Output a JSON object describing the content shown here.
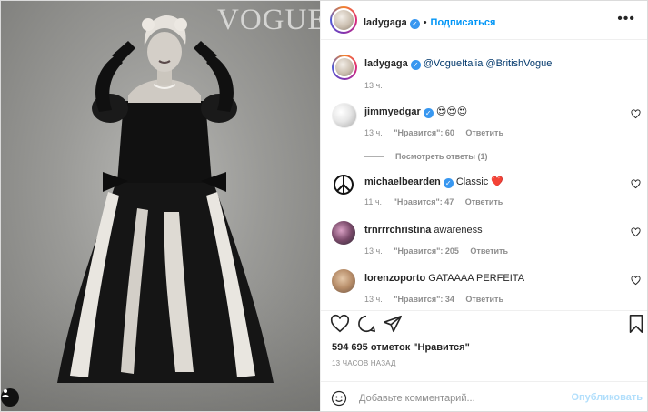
{
  "post": {
    "author": "ladygaga",
    "follow_label": "Подписаться",
    "separator": "•",
    "more_label": "•••",
    "photo": {
      "masthead": "VOGUE"
    },
    "caption": {
      "username": "ladygaga",
      "text": "@VogueItalia @BritishVogue",
      "time": "13 ч."
    },
    "comments": [
      {
        "username": "jimmyedgar",
        "verified": true,
        "text": "😍😍😍",
        "time": "13 ч.",
        "likes": "\"Нравится\": 60",
        "reply": "Ответить",
        "view_replies": "Посмотреть ответы (1)"
      },
      {
        "username": "michaelbearden",
        "verified": true,
        "text": "Classic ❤️",
        "time": "11 ч.",
        "likes": "\"Нравится\": 47",
        "reply": "Ответить"
      },
      {
        "username": "trnrrrchristina",
        "verified": false,
        "text": "awareness",
        "time": "13 ч.",
        "likes": "\"Нравится\": 205",
        "reply": "Ответить"
      },
      {
        "username": "lorenzoporto",
        "verified": false,
        "text": "GATAAAA PERFEITA",
        "time": "13 ч.",
        "likes": "\"Нравится\": 34",
        "reply": "Ответить"
      }
    ],
    "likes_text": "594 695 отметок \"Нравится\"",
    "timestamp": "13 ЧАСОВ НАЗАД",
    "comment_input": {
      "placeholder": "Добавьте комментарий...",
      "value": ""
    },
    "publish_label": "Опубликовать"
  },
  "icons": {
    "header_avatar": "profile-photo",
    "verified": "verified-badge-icon",
    "like": "heart-icon",
    "comment": "comment-bubble-icon",
    "share": "paper-plane-icon",
    "save": "bookmark-icon",
    "emoji": "smiley-icon",
    "tag": "user-tag-icon"
  },
  "colors": {
    "accent": "#0095f6",
    "verified": "#3897f0",
    "muted": "#8e8e8e",
    "heart": "#ed4956",
    "publish_disabled": "#b2dffc"
  }
}
